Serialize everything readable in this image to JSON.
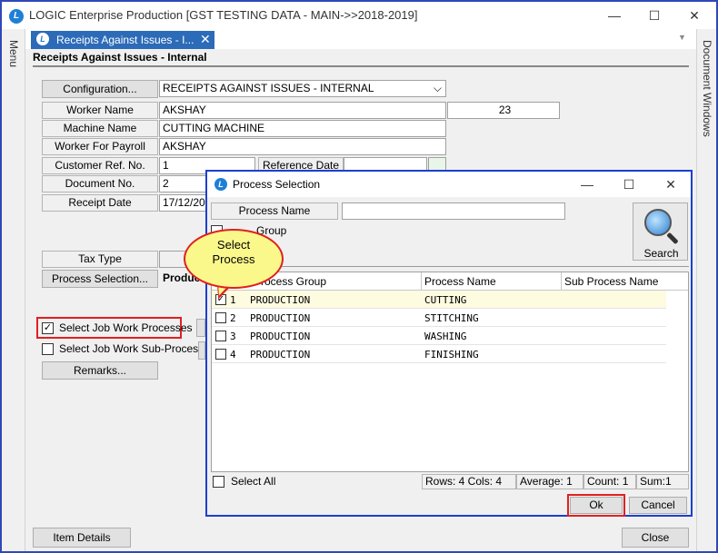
{
  "window": {
    "title": "LOGIC Enterprise Production  [GST TESTING DATA - MAIN->>2018-2019]",
    "app_icon": "L",
    "minimize": "—",
    "maximize": "☐",
    "close": "✕"
  },
  "side": {
    "left_label": "Menu",
    "right_label": "Document Windows"
  },
  "tab": {
    "label": "Receipts Against Issues - I...",
    "close": "✕",
    "overflow": "▼"
  },
  "form": {
    "heading": "Receipts Against Issues - Internal",
    "configuration_button": "Configuration...",
    "configuration_value": "RECEIPTS AGAINST ISSUES - INTERNAL",
    "dropdown_arrow": "⌵",
    "worker_name_label": "Worker Name",
    "worker_name_value": "AKSHAY",
    "worker_code": "23",
    "machine_name_label": "Machine Name",
    "machine_name_value": "CUTTING MACHINE",
    "worker_payroll_label": "Worker For Payroll",
    "worker_payroll_value": "AKSHAY",
    "customer_ref_label": "Customer Ref. No.",
    "customer_ref_value": "1",
    "reference_date_label": "Reference Date",
    "document_no_label": "Document No.",
    "document_no_value": "2",
    "receipt_date_label": "Receipt Date",
    "receipt_date_value": "17/12/20",
    "tax_type_label": "Tax Type",
    "process_selection_button": "Process Selection...",
    "process_selection_value": "Produc",
    "select_job_work_label": "Select Job Work Processes",
    "select_job_work_sub_label": "Select Job Work Sub-Process",
    "remarks_button": "Remarks...",
    "item_details_button": "Item Details",
    "close_button": "Close",
    "check_mark": "✓"
  },
  "dialog": {
    "title": "Process Selection",
    "icon": "L",
    "minimize": "—",
    "maximize": "☐",
    "close": "✕",
    "process_name_label": "Process Name",
    "process_name_value": "",
    "group_label": "Group",
    "search_label": "Search",
    "columns": [
      "Process Group",
      "Process Name",
      "Sub Process Name"
    ],
    "rows": [
      {
        "no": "1",
        "checked": "✓",
        "group": "PRODUCTION",
        "name": "CUTTING",
        "sub": ""
      },
      {
        "no": "2",
        "checked": "",
        "group": "PRODUCTION",
        "name": "STITCHING",
        "sub": ""
      },
      {
        "no": "3",
        "checked": "",
        "group": "PRODUCTION",
        "name": "WASHING",
        "sub": ""
      },
      {
        "no": "4",
        "checked": "",
        "group": "PRODUCTION",
        "name": "FINISHING",
        "sub": ""
      }
    ],
    "select_all_label": "Select All",
    "status": {
      "rows_cols": "Rows: 4  Cols: 4",
      "average": "Average: 1",
      "count": "Count: 1",
      "sum": "Sum:1"
    },
    "ok_button": "Ok",
    "cancel_button": "Cancel"
  },
  "callout": {
    "line1": "Select",
    "line2": "Process"
  },
  "colors": {
    "accent_blue": "#2c6bb8",
    "dialog_border": "#1c3fd0",
    "highlight_red": "#e02020",
    "callout_yellow": "#fbf88b",
    "selected_row": "#fdfbe0"
  }
}
